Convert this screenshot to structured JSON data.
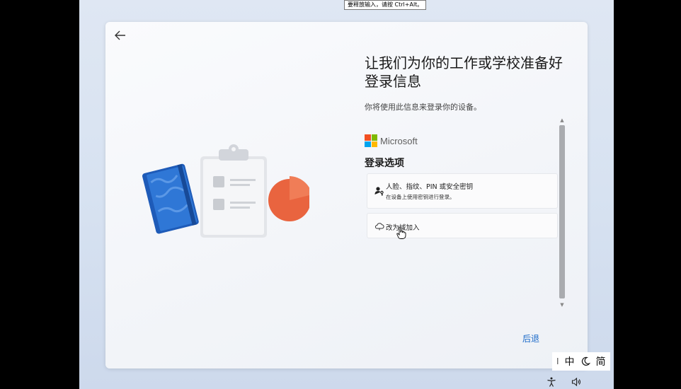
{
  "tooltip": "要释放输入，请按 Ctrl+Alt。",
  "page": {
    "title": "让我们为你的工作或学校准备好登录信息",
    "subtitle": "你将使用此信息来登录你的设备。",
    "brand": "Microsoft",
    "section_title": "登录选项",
    "options": [
      {
        "title": "人脸、指纹、PIN 或安全密钥",
        "description": "在设备上使用密钥进行登录。",
        "icon": "person-key-icon"
      },
      {
        "title": "改为域加入",
        "icon": "domain-join-icon"
      }
    ],
    "back_link": "后退"
  },
  "ime": {
    "separator": "I",
    "mode": "中",
    "half_full": "moon-icon",
    "script": "简"
  },
  "tray": [
    "accessibility-icon",
    "volume-icon"
  ],
  "colors": {
    "accent": "#1b6ac9",
    "ms_red": "#f25022",
    "ms_green": "#7fba00",
    "ms_blue": "#00a4ef",
    "ms_yellow": "#ffb900"
  }
}
